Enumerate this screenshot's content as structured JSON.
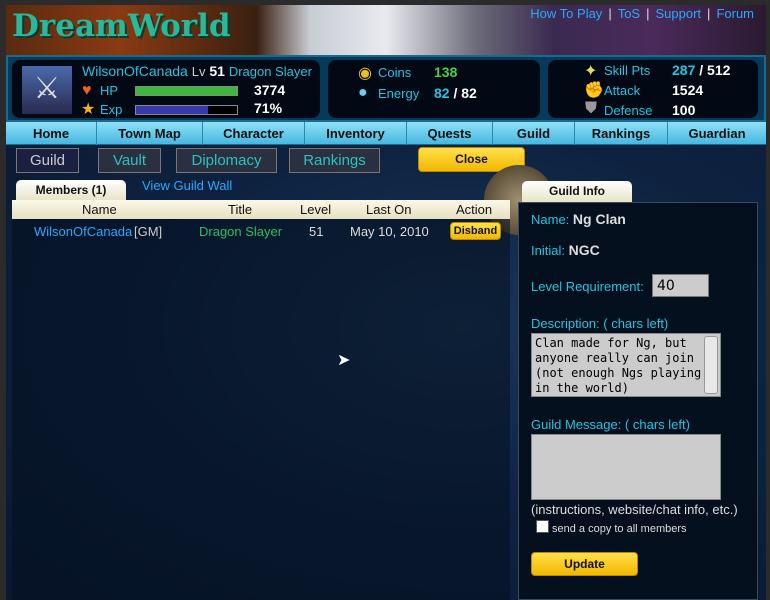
{
  "header": {
    "logo": "DreamWorld",
    "links": [
      "How To Play",
      "ToS",
      "Support",
      "Forum"
    ]
  },
  "player": {
    "name": "WilsonOfCanada",
    "lv_label": "Lv",
    "level": "51",
    "title": "Dragon Slayer",
    "hp_label": "HP",
    "hp": "3774",
    "hp_fill": 1.0,
    "exp_label": "Exp",
    "exp": "71%",
    "exp_fill": 0.71,
    "coins_label": "Coins",
    "coins": "138",
    "energy_label": "Energy",
    "energy": "82",
    "energy_max": "82",
    "skill_label": "Skill Pts",
    "skill": "287",
    "skill_max": "512",
    "attack_label": "Attack",
    "attack": "1524",
    "defense_label": "Defense",
    "defense": "100"
  },
  "nav": [
    "Home",
    "Town Map",
    "Character",
    "Inventory",
    "Quests",
    "Guild",
    "Rankings",
    "Guardian"
  ],
  "subtabs": [
    "Guild",
    "Vault",
    "Diplomacy",
    "Rankings"
  ],
  "close_label": "Close",
  "members": {
    "tab": "Members (1)",
    "wall_link": "View Guild Wall",
    "columns": [
      "Name",
      "Title",
      "Level",
      "Last On",
      "Action"
    ],
    "rows": [
      {
        "name": "WilsonOfCanada",
        "rank": "[GM]",
        "title": "Dragon Slayer",
        "level": "51",
        "last_on": "May 10, 2010",
        "action": "Disband"
      }
    ]
  },
  "guild_info": {
    "tab": "Guild Info",
    "name_label": "Name:",
    "name": "Ng Clan",
    "initial_label": "Initial:",
    "initial": "NGC",
    "level_req_label": "Level Requirement:",
    "level_req": "40",
    "description_label": "Description: ( chars left)",
    "description": "Clan made for Ng, but anyone really can join (not enough Ngs playing in the world)",
    "message_label": "Guild Message: ( chars left)",
    "message": "",
    "message_hint": "(instructions, website/chat info, etc.)",
    "send_copy_label": "send a copy to all members",
    "update_label": "Update"
  }
}
